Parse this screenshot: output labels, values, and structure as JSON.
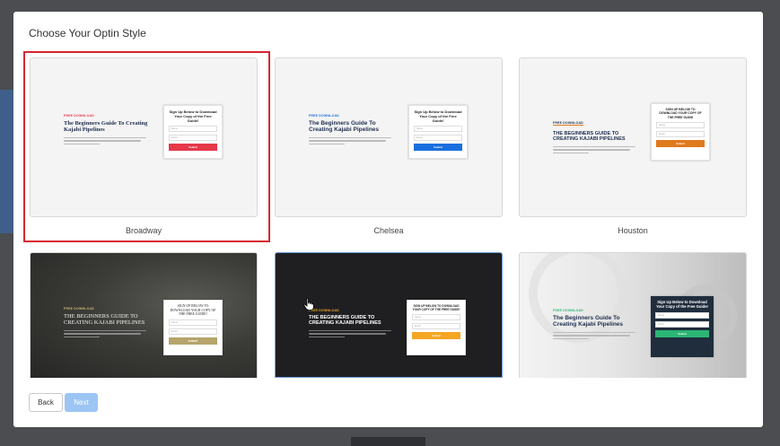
{
  "modal": {
    "title": "Choose Your Optin Style"
  },
  "styles": [
    {
      "label": "Broadway",
      "tag": "FREE DOWNLOAD",
      "headline": "The Beginners Guide To Creating Kajabi Pipelines",
      "form_title": "Sign Up Below to Download Your Copy of the Free Guide!",
      "field1": "Name",
      "field2": "Email",
      "button": "Submit"
    },
    {
      "label": "Chelsea",
      "tag": "FREE DOWNLOAD",
      "headline": "The Beginners Guide To Creating Kajabi Pipelines",
      "form_title": "Sign Up Below to Download Your Copy of the Free Guide!",
      "field1": "Name",
      "field2": "Email",
      "button": "Submit"
    },
    {
      "label": "Houston",
      "tag": "FREE DOWNLOAD",
      "headline": "THE BEGINNERS GUIDE TO CREATING KAJABI PIPELINES",
      "form_title": "SIGN UP BELOW TO DOWNLOAD YOUR COPY OF THE FREE GUIDE",
      "field1": "Name",
      "field2": "Email",
      "button": "Submit"
    },
    {
      "tag": "FREE DOWNLOAD",
      "headline": "THE BEGINNERS GUIDE TO CREATING KAJABI PIPELINES",
      "form_title": "SIGN UP BELOW TO DOWNLOAD YOUR COPY OF THE FREE GUIDE!",
      "field1": "Name",
      "field2": "Email",
      "button": "SUBMIT"
    },
    {
      "tag": "FREE DOWNLOAD",
      "headline": "THE BEGINNERS GUIDE TO CREATING KAJABI PIPELINES",
      "form_title": "SIGN UP BELOW TO DOWNLOAD YOUR COPY OF THE FREE GUIDE!",
      "field1": "Name",
      "field2": "Email",
      "button": "Submit"
    },
    {
      "tag": "FREE DOWNLOAD",
      "headline": "The Beginners Guide To Creating Kajabi Pipelines",
      "form_title": "Sign Up Below to Download Your Copy of the Free Guide!",
      "field1": "Name",
      "field2": "Email",
      "button": "Submit"
    }
  ],
  "buttons": {
    "back": "Back",
    "next": "Next"
  },
  "colors": {
    "selected_outline": "#d8262f",
    "broadway_accent": "#e5394a",
    "chelsea_accent": "#1a6fe0",
    "houston_accent": "#e07a1f",
    "fourth_accent": "#b6a46a",
    "fifth_accent": "#f5a623",
    "sixth_accent": "#2bb673",
    "next_button": "#9cc5f4"
  },
  "icons": {
    "cursor": "pointer-hand-icon"
  }
}
